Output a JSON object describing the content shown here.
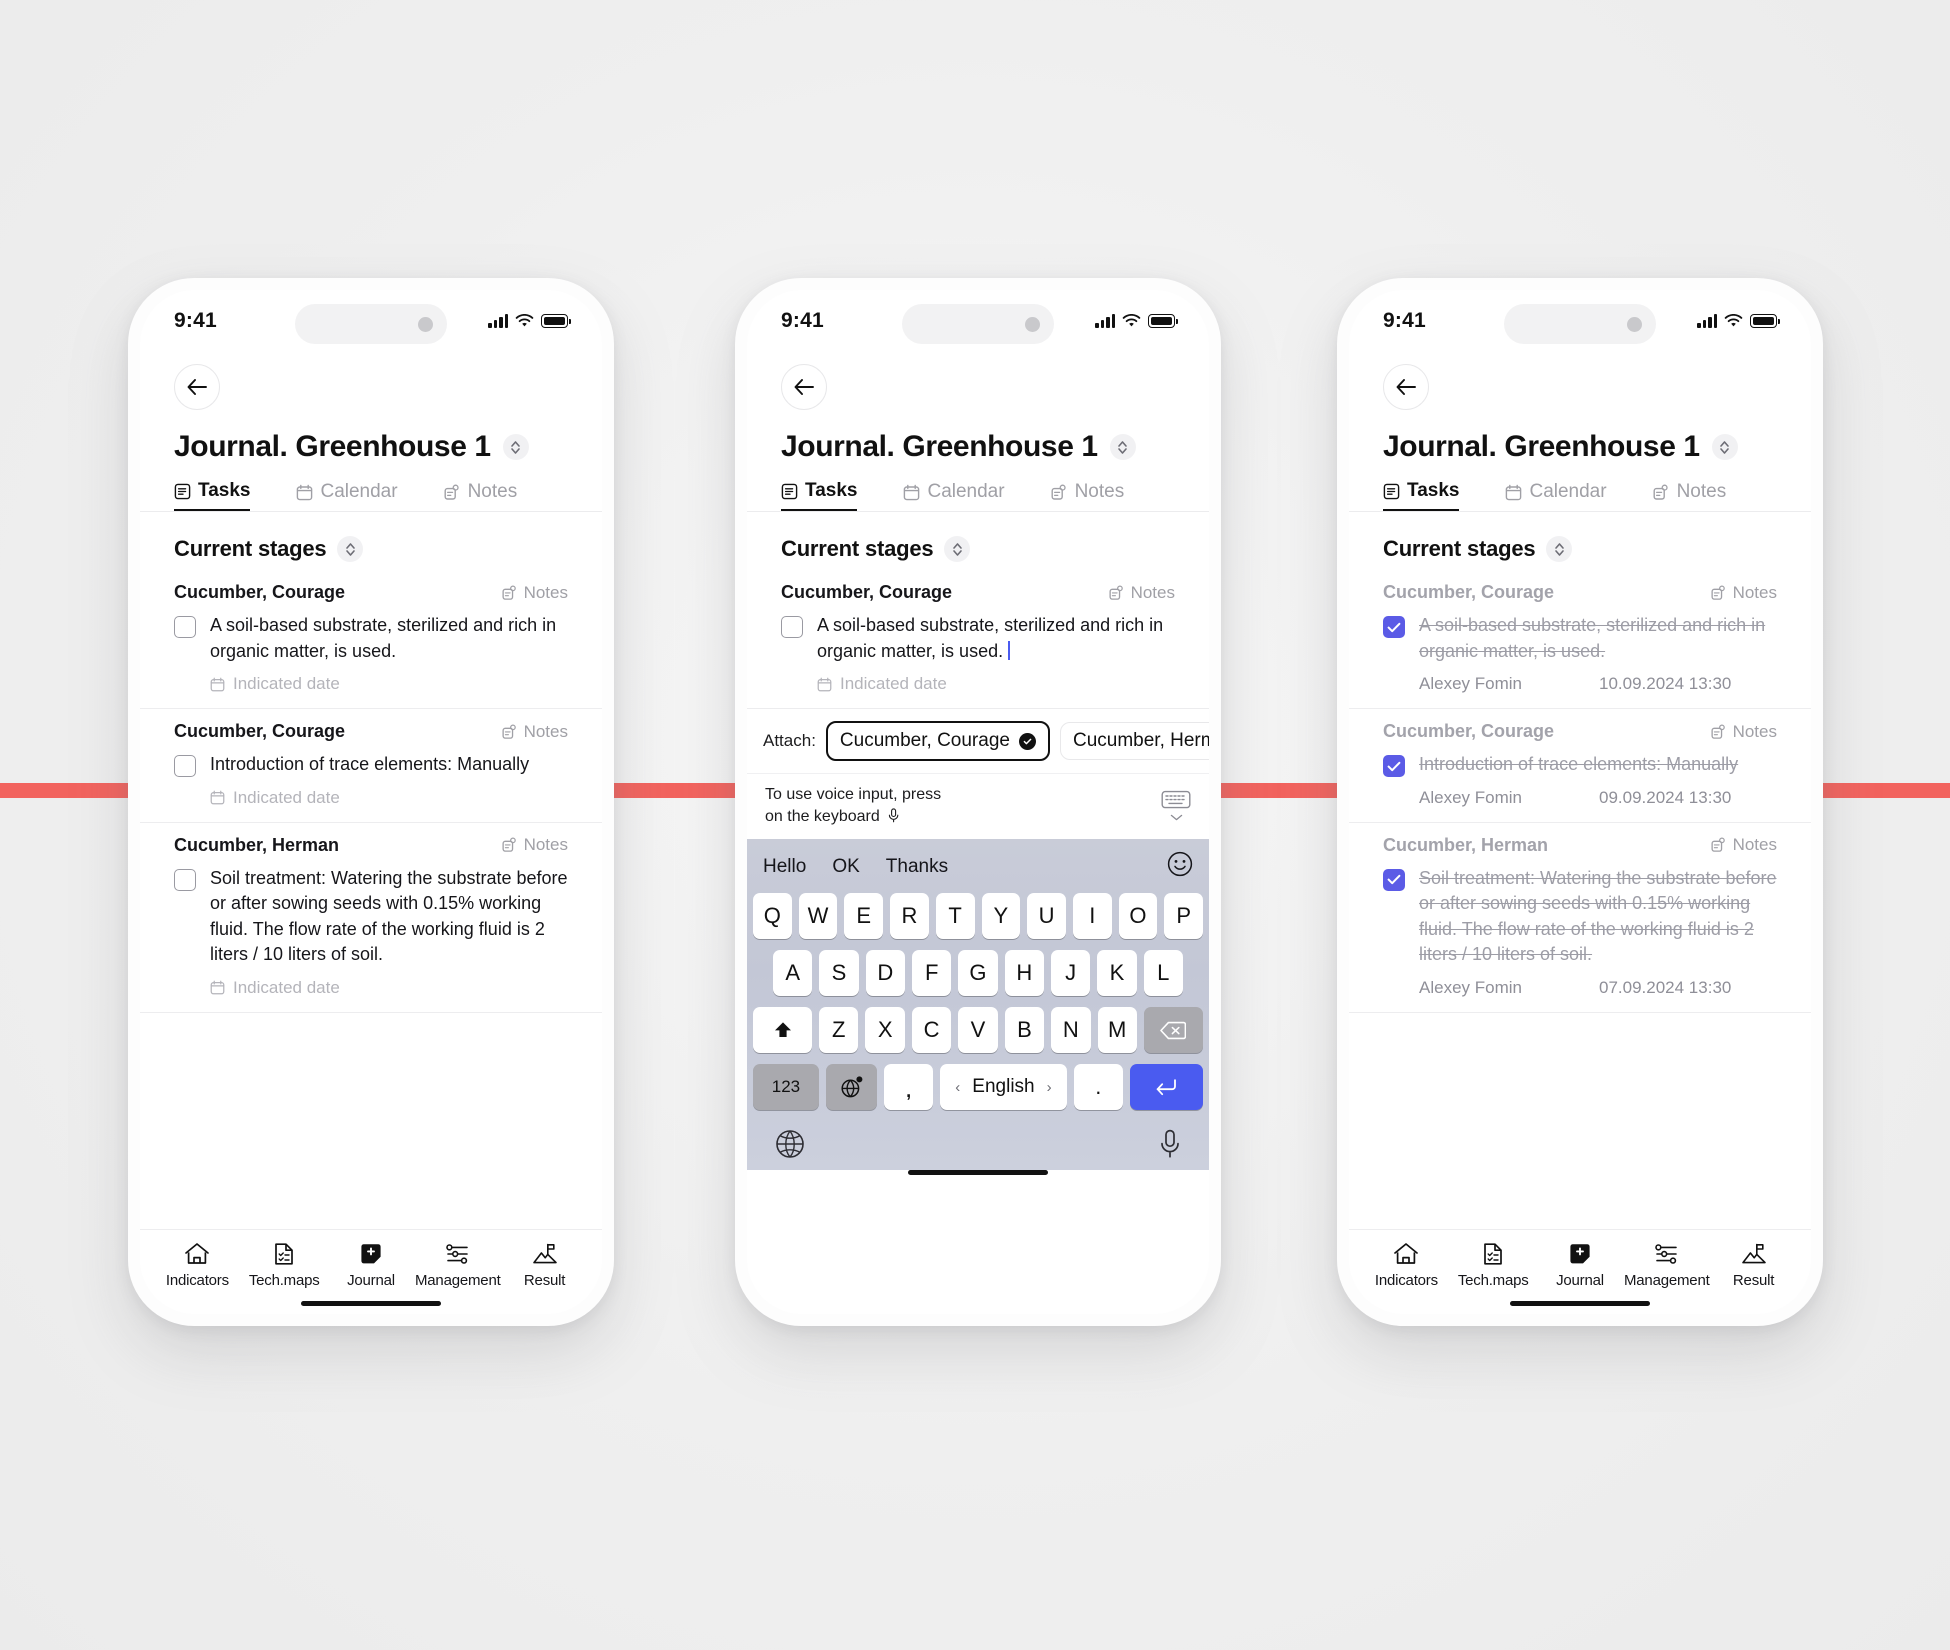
{
  "status_bar": {
    "time": "9:41"
  },
  "header": {
    "title": "Journal. Greenhouse 1",
    "tabs": [
      {
        "label": "Tasks",
        "icon": "tasks-icon",
        "active": true
      },
      {
        "label": "Calendar",
        "icon": "calendar-icon",
        "active": false
      },
      {
        "label": "Notes",
        "icon": "notes-icon",
        "active": false
      }
    ]
  },
  "section": {
    "title": "Current stages"
  },
  "labels": {
    "notes": "Notes",
    "indicated_date": "Indicated date",
    "attach": "Attach:"
  },
  "tasks": [
    {
      "crop": "Cucumber, Courage",
      "text": "A soil-based substrate, sterilized and rich in organic matter, is used.",
      "date_placeholder": "Indicated date",
      "done_by": "Alexey Fomin",
      "done_at": "10.09.2024 13:30"
    },
    {
      "crop": "Cucumber, Courage",
      "text": "Introduction of trace elements: Manually",
      "date_placeholder": "Indicated date",
      "done_by": "Alexey Fomin",
      "done_at": "09.09.2024 13:30"
    },
    {
      "crop": "Cucumber, Herman",
      "text": "Soil treatment: Watering the substrate before or after sowing seeds with 0.15% working fluid. The flow rate of the working fluid is 2 liters / 10 liters of soil.",
      "date_placeholder": "Indicated date",
      "done_by": "Alexey Fomin",
      "done_at": "07.09.2024 13:30"
    }
  ],
  "bottom_nav": [
    {
      "label": "Indicators",
      "icon": "home-icon"
    },
    {
      "label": "Tech.maps",
      "icon": "document-check-icon"
    },
    {
      "label": "Journal",
      "icon": "journal-plus-icon",
      "active": true
    },
    {
      "label": "Management",
      "icon": "sliders-icon"
    },
    {
      "label": "Result",
      "icon": "flag-mountain-icon"
    }
  ],
  "attach": {
    "label": "Attach:",
    "chips": [
      {
        "label": "Cucumber, Courage",
        "selected": true
      },
      {
        "label": "Cucumber, Herman",
        "selected": false
      }
    ]
  },
  "voice_hint": {
    "line1": "To use voice input, press",
    "line2": "on the keyboard"
  },
  "keyboard": {
    "suggestions": [
      "Hello",
      "OK",
      "Thanks"
    ],
    "row1": [
      "Q",
      "W",
      "E",
      "R",
      "T",
      "Y",
      "U",
      "I",
      "O",
      "P"
    ],
    "row2": [
      "A",
      "S",
      "D",
      "F",
      "G",
      "H",
      "J",
      "K",
      "L"
    ],
    "row3": [
      "Z",
      "X",
      "C",
      "V",
      "B",
      "N",
      "M"
    ],
    "shift_key": "shift-icon",
    "backspace_key": "backspace-icon",
    "numbers_key": "123",
    "globe_key": "globe-gear-icon",
    "comma_key": ",",
    "space_key": "English",
    "space_prev": "‹",
    "space_next": "›",
    "period_key": ".",
    "return_key": "return-icon",
    "bottom_globe": "globe-icon",
    "bottom_mic": "mic-icon",
    "emoji": "emoji-icon"
  },
  "colors": {
    "accent": "#5b5be6",
    "return_key": "#4a5bf0",
    "red_guide": "#f2635e",
    "text": "#16161a",
    "muted": "#a0a0a6"
  }
}
